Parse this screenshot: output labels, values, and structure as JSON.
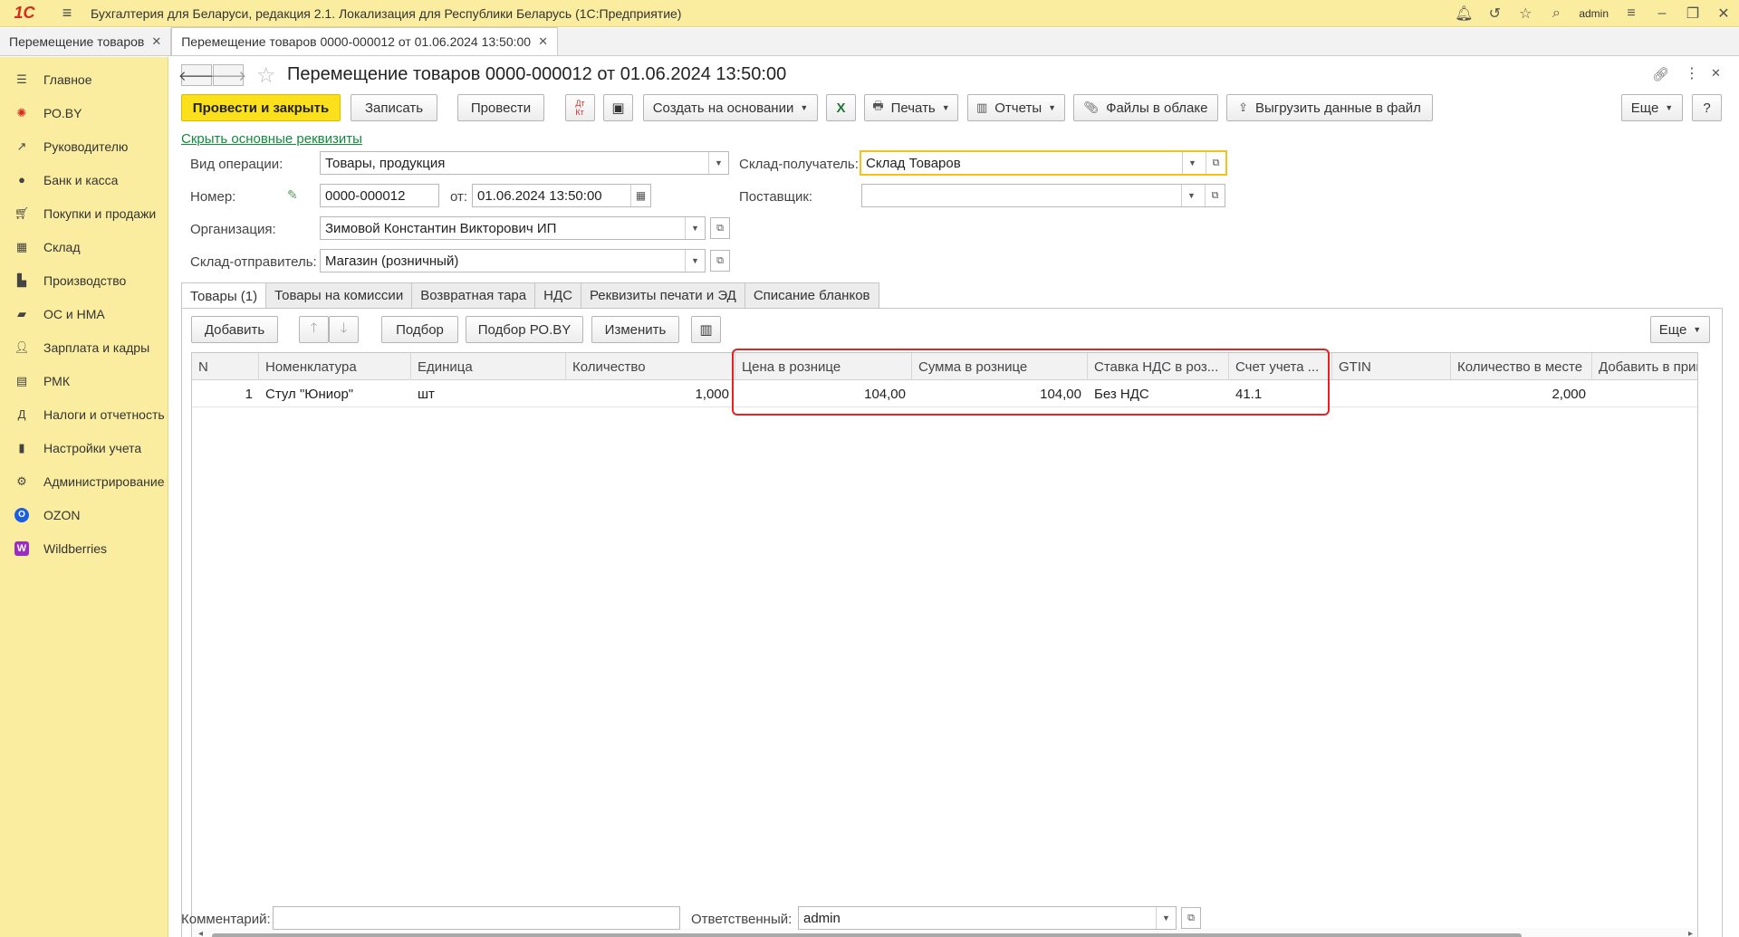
{
  "app": {
    "logo": "1С",
    "title": "Бухгалтерия для Беларуси, редакция 2.1. Локализация для Республики Беларусь   (1С:Предприятие)",
    "user": "admin",
    "icons": [
      "bell-icon",
      "history-icon",
      "star-icon",
      "search-icon",
      "settings-icon",
      "minimize-icon",
      "restore-icon",
      "close-icon"
    ]
  },
  "window_tabs": [
    {
      "label": "Перемещение товаров",
      "active": false
    },
    {
      "label": "Перемещение товаров 0000-000012 от 01.06.2024 13:50:00",
      "active": true
    }
  ],
  "sidebar": {
    "items": [
      {
        "label": "Главное",
        "icon": "menu-icon"
      },
      {
        "label": "РО.BY",
        "icon": "roby-icon"
      },
      {
        "label": "Руководителю",
        "icon": "chart-icon"
      },
      {
        "label": "Банк и касса",
        "icon": "coin-icon"
      },
      {
        "label": "Покупки и продажи",
        "icon": "cart-icon"
      },
      {
        "label": "Склад",
        "icon": "warehouse-icon"
      },
      {
        "label": "Производство",
        "icon": "factory-icon"
      },
      {
        "label": "ОС и НМА",
        "icon": "truck-icon"
      },
      {
        "label": "Зарплата и кадры",
        "icon": "person-icon"
      },
      {
        "label": "РМК",
        "icon": "register-icon"
      },
      {
        "label": "Налоги и отчетность",
        "icon": "tax-icon"
      },
      {
        "label": "Настройки учета",
        "icon": "book-icon"
      },
      {
        "label": "Администрирование",
        "icon": "gear-icon"
      },
      {
        "label": "OZON",
        "icon": "ozon-icon"
      },
      {
        "label": "Wildberries",
        "icon": "wildberries-icon"
      }
    ]
  },
  "form": {
    "title": "Перемещение товаров 0000-000012 от 01.06.2024 13:50:00",
    "toolbar": {
      "post_close": "Провести и закрыть",
      "save": "Записать",
      "post": "Провести",
      "create_based": "Создать на основании",
      "print": "Печать",
      "reports": "Отчеты",
      "cloud_files": "Файлы в облаке",
      "export": "Выгрузить данные в файл",
      "more": "Еще",
      "help": "?"
    },
    "hide_link": "Скрыть основные реквизиты",
    "fields": {
      "operation_label": "Вид операции:",
      "operation_value": "Товары, продукция",
      "number_label": "Номер:",
      "number_value": "0000-000012",
      "date_label": "от:",
      "date_value": "01.06.2024 13:50:00",
      "org_label": "Организация:",
      "org_value": "Зимовой Константин Викторович ИП",
      "sender_label": "Склад-отправитель:",
      "sender_value": "Магазин (розничный)",
      "receiver_label": "Склад-получатель:",
      "receiver_value": "Склад Товаров",
      "supplier_label": "Поставщик:",
      "supplier_value": ""
    },
    "tabs": [
      "Товары (1)",
      "Товары на комиссии",
      "Возвратная тара",
      "НДС",
      "Реквизиты печати и ЭД",
      "Списание бланков"
    ],
    "table_toolbar": {
      "add": "Добавить",
      "pick": "Подбор",
      "pick_roby": "Подбор РО.BY",
      "change": "Изменить",
      "more": "Еще"
    },
    "table": {
      "columns": [
        "N",
        "Номенклатура",
        "Единица",
        "Количество",
        "Цена в рознице",
        "Сумма в рознице",
        "Ставка НДС в роз...",
        "Счет учета ...",
        "GTIN",
        "Количество в месте",
        "Добавить в приме"
      ],
      "rows": [
        [
          "1",
          "Стул \"Юниор\"",
          "шт",
          "1,000",
          "104,00",
          "104,00",
          "Без НДС",
          "41.1",
          "",
          "2,000",
          ""
        ]
      ]
    },
    "footer": {
      "comment_label": "Комментарий:",
      "comment_value": "",
      "responsible_label": "Ответственный:",
      "responsible_value": "admin"
    }
  }
}
